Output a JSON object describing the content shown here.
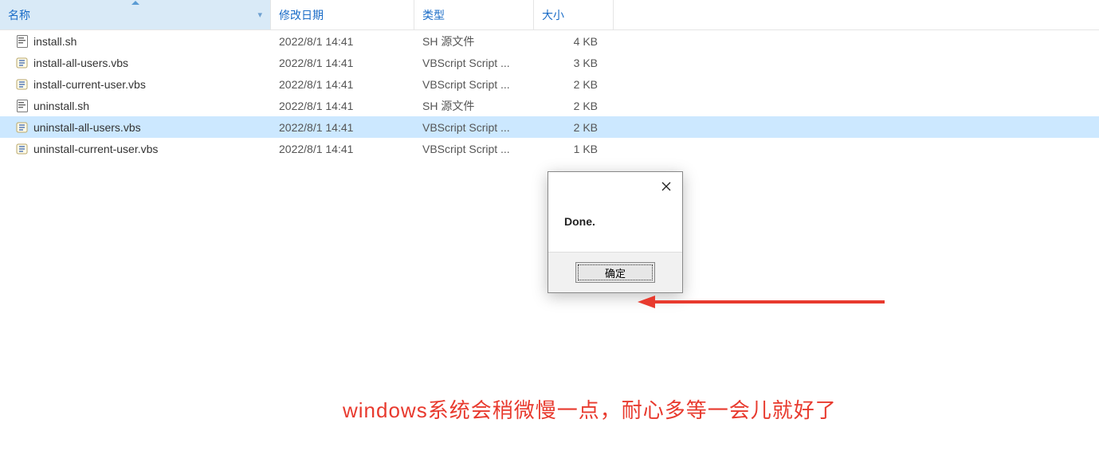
{
  "columns": {
    "name": "名称",
    "date": "修改日期",
    "type": "类型",
    "size": "大小"
  },
  "files": [
    {
      "name": "install.sh",
      "date": "2022/8/1 14:41",
      "type": "SH 源文件",
      "size": "4 KB",
      "icon": "sh",
      "selected": false
    },
    {
      "name": "install-all-users.vbs",
      "date": "2022/8/1 14:41",
      "type": "VBScript Script ...",
      "size": "3 KB",
      "icon": "vbs",
      "selected": false
    },
    {
      "name": "install-current-user.vbs",
      "date": "2022/8/1 14:41",
      "type": "VBScript Script ...",
      "size": "2 KB",
      "icon": "vbs",
      "selected": false
    },
    {
      "name": "uninstall.sh",
      "date": "2022/8/1 14:41",
      "type": "SH 源文件",
      "size": "2 KB",
      "icon": "sh",
      "selected": false
    },
    {
      "name": "uninstall-all-users.vbs",
      "date": "2022/8/1 14:41",
      "type": "VBScript Script ...",
      "size": "2 KB",
      "icon": "vbs",
      "selected": true
    },
    {
      "name": "uninstall-current-user.vbs",
      "date": "2022/8/1 14:41",
      "type": "VBScript Script ...",
      "size": "1 KB",
      "icon": "vbs",
      "selected": false
    }
  ],
  "dialog": {
    "message": "Done.",
    "ok_label": "确定"
  },
  "annotation": {
    "caption": "windows系统会稍微慢一点，耐心多等一会儿就好了"
  }
}
